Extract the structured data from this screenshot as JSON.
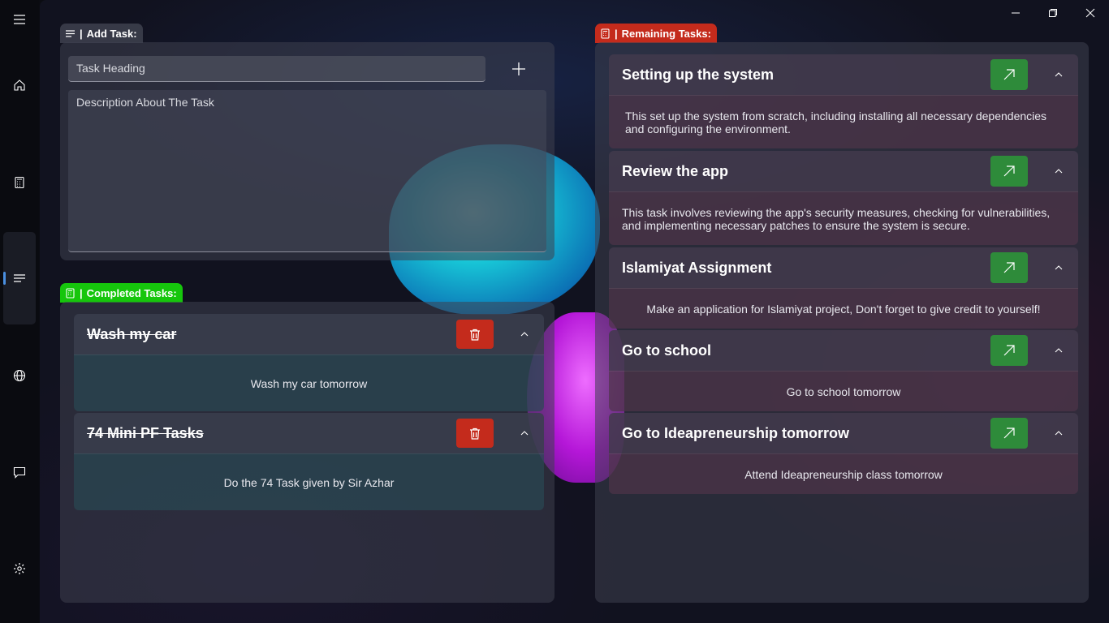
{
  "window": {
    "minimize_icon": "minimize-icon",
    "maximize_icon": "restore-icon",
    "close_icon": "close-icon"
  },
  "nav": {
    "items": [
      "hamburger-icon",
      "home-icon",
      "calculator-icon",
      "tasks-icon",
      "globe-icon",
      "chat-icon",
      "settings-icon"
    ],
    "active": "tasks-icon",
    "accent_color": "#4a8fe0"
  },
  "add_task": {
    "label": "Add Task:",
    "heading_placeholder": "Task Heading",
    "description_placeholder": "Description About The Task",
    "add_icon": "plus-icon"
  },
  "completed": {
    "label": "Completed Tasks:",
    "color": "#16c60c",
    "tasks": [
      {
        "title": "Wash my car",
        "description": "Wash my car tomorrow"
      },
      {
        "title": "74 Mini PF Tasks",
        "description": "Do the 74 Task given by Sir Azhar"
      }
    ]
  },
  "remaining": {
    "label": "Remaining Tasks:",
    "color": "#c42b1c",
    "tasks": [
      {
        "title": "Setting up the system",
        "description": "This set up the system from scratch, including installing all necessary dependencies and configuring the environment."
      },
      {
        "title": "Review the app",
        "description": "This task involves reviewing the app's security measures, checking for vulnerabilities, and implementing necessary patches to ensure the system is secure."
      },
      {
        "title": "Islamiyat Assignment",
        "description": "Make an application for Islamiyat project, Don't forget to give credit to yourself!"
      },
      {
        "title": "Go to school",
        "description": "Go to school tomorrow"
      },
      {
        "title": "Go to Ideapreneurship tomorrow",
        "description": "Attend Ideapreneurship class tomorrow"
      }
    ]
  }
}
